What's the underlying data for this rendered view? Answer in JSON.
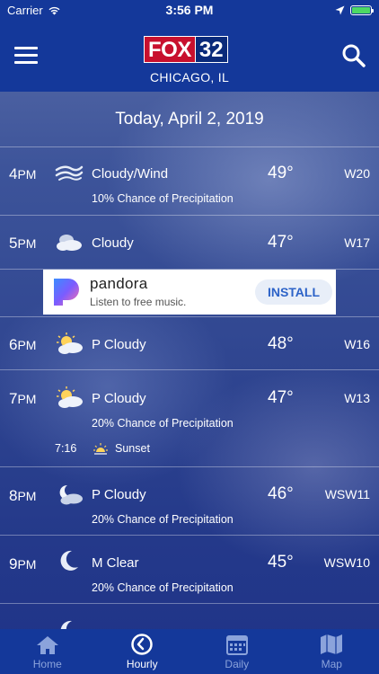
{
  "status_bar": {
    "carrier": "Carrier",
    "time": "3:56 PM"
  },
  "header": {
    "logo_brand": "FOX",
    "logo_channel": "32",
    "city": "CHICAGO, IL"
  },
  "date_heading": "Today, April 2, 2019",
  "hours": [
    {
      "hour": "4",
      "ampm": "PM",
      "icon": "wind-cloud-icon",
      "condition": "Cloudy/Wind",
      "temp": "49°",
      "wind": "W20",
      "precip": "10% Chance of Precipitation"
    },
    {
      "hour": "5",
      "ampm": "PM",
      "icon": "cloudy-icon",
      "condition": "Cloudy",
      "temp": "47°",
      "wind": "W17",
      "precip": ""
    },
    {
      "hour": "6",
      "ampm": "PM",
      "icon": "partly-cloudy-icon",
      "condition": "P Cloudy",
      "temp": "48°",
      "wind": "W16",
      "precip": ""
    },
    {
      "hour": "7",
      "ampm": "PM",
      "icon": "partly-cloudy-icon",
      "condition": "P Cloudy",
      "temp": "47°",
      "wind": "W13",
      "precip": "20% Chance of Precipitation",
      "sunset_time": "7:16",
      "sunset_label": "Sunset"
    },
    {
      "hour": "8",
      "ampm": "PM",
      "icon": "moon-cloud-icon",
      "condition": "P Cloudy",
      "temp": "46°",
      "wind": "WSW11",
      "precip": "20% Chance of Precipitation"
    },
    {
      "hour": "9",
      "ampm": "PM",
      "icon": "moon-icon",
      "condition": "M Clear",
      "temp": "45°",
      "wind": "WSW10",
      "precip": "20% Chance of Precipitation"
    }
  ],
  "ad": {
    "brand": "pandora",
    "tagline": "Listen to free music.",
    "cta": "INSTALL"
  },
  "tabs": [
    {
      "label": "Home",
      "icon": "home-icon"
    },
    {
      "label": "Hourly",
      "icon": "clock-icon"
    },
    {
      "label": "Daily",
      "icon": "calendar-icon"
    },
    {
      "label": "Map",
      "icon": "map-icon"
    }
  ],
  "colors": {
    "header": "#14389a",
    "fox_red": "#c8102e",
    "install_blue": "#2d63c8"
  }
}
